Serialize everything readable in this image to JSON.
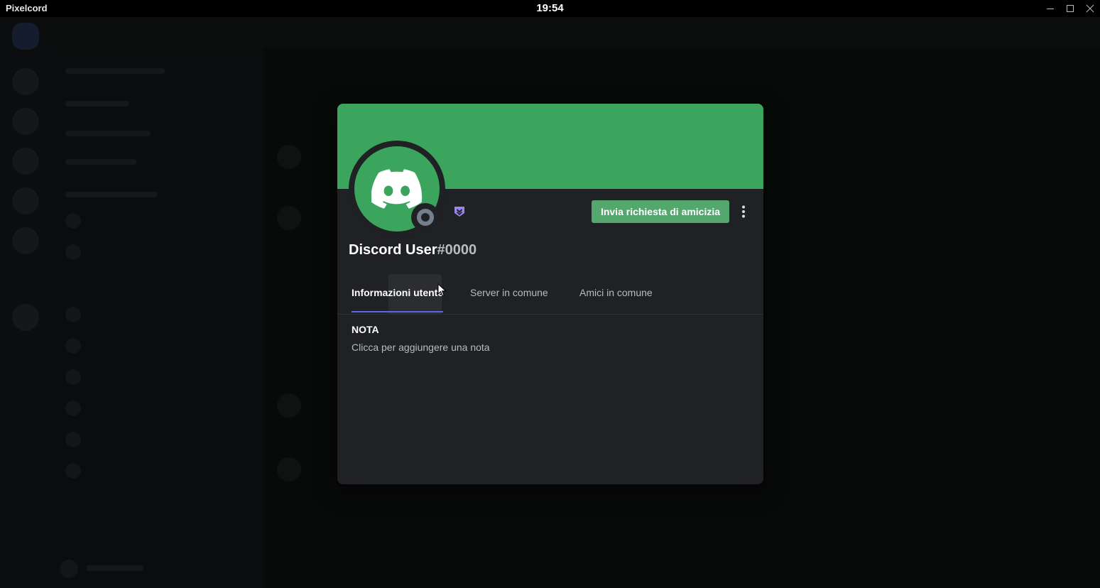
{
  "titlebar": {
    "app_name": "Pixelcord",
    "time": "19:54"
  },
  "profile_modal": {
    "banner_color": "#3ba55d",
    "avatar_color": "#3ba55d",
    "status": "offline",
    "badge": "hypesquad-badge-icon",
    "friend_request_button": "Invia richiesta di amicizia",
    "friend_button_color": "#54a86e",
    "username": "Discord User",
    "discriminator": "#0000",
    "tabs": [
      {
        "label": "Informazioni utente",
        "active": true
      },
      {
        "label": "Server in comune",
        "active": false
      },
      {
        "label": "Amici in comune",
        "active": false
      }
    ],
    "accent_color": "#5865f2",
    "note": {
      "title": "NOTA",
      "placeholder": "Clicca per aggiungere una nota"
    }
  }
}
